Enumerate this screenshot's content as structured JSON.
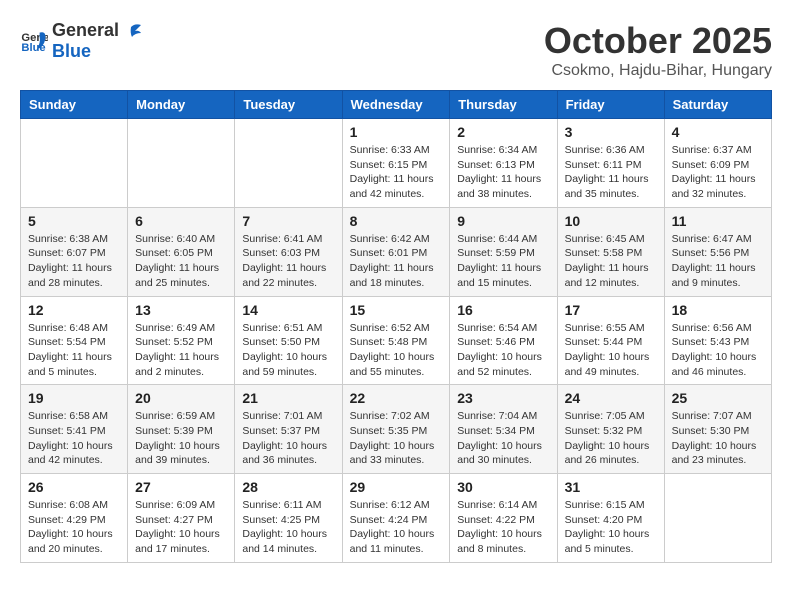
{
  "header": {
    "logo_general": "General",
    "logo_blue": "Blue",
    "month": "October 2025",
    "location": "Csokmo, Hajdu-Bihar, Hungary"
  },
  "weekdays": [
    "Sunday",
    "Monday",
    "Tuesday",
    "Wednesday",
    "Thursday",
    "Friday",
    "Saturday"
  ],
  "weeks": [
    [
      {
        "day": "",
        "info": ""
      },
      {
        "day": "",
        "info": ""
      },
      {
        "day": "",
        "info": ""
      },
      {
        "day": "1",
        "info": "Sunrise: 6:33 AM\nSunset: 6:15 PM\nDaylight: 11 hours\nand 42 minutes."
      },
      {
        "day": "2",
        "info": "Sunrise: 6:34 AM\nSunset: 6:13 PM\nDaylight: 11 hours\nand 38 minutes."
      },
      {
        "day": "3",
        "info": "Sunrise: 6:36 AM\nSunset: 6:11 PM\nDaylight: 11 hours\nand 35 minutes."
      },
      {
        "day": "4",
        "info": "Sunrise: 6:37 AM\nSunset: 6:09 PM\nDaylight: 11 hours\nand 32 minutes."
      }
    ],
    [
      {
        "day": "5",
        "info": "Sunrise: 6:38 AM\nSunset: 6:07 PM\nDaylight: 11 hours\nand 28 minutes."
      },
      {
        "day": "6",
        "info": "Sunrise: 6:40 AM\nSunset: 6:05 PM\nDaylight: 11 hours\nand 25 minutes."
      },
      {
        "day": "7",
        "info": "Sunrise: 6:41 AM\nSunset: 6:03 PM\nDaylight: 11 hours\nand 22 minutes."
      },
      {
        "day": "8",
        "info": "Sunrise: 6:42 AM\nSunset: 6:01 PM\nDaylight: 11 hours\nand 18 minutes."
      },
      {
        "day": "9",
        "info": "Sunrise: 6:44 AM\nSunset: 5:59 PM\nDaylight: 11 hours\nand 15 minutes."
      },
      {
        "day": "10",
        "info": "Sunrise: 6:45 AM\nSunset: 5:58 PM\nDaylight: 11 hours\nand 12 minutes."
      },
      {
        "day": "11",
        "info": "Sunrise: 6:47 AM\nSunset: 5:56 PM\nDaylight: 11 hours\nand 9 minutes."
      }
    ],
    [
      {
        "day": "12",
        "info": "Sunrise: 6:48 AM\nSunset: 5:54 PM\nDaylight: 11 hours\nand 5 minutes."
      },
      {
        "day": "13",
        "info": "Sunrise: 6:49 AM\nSunset: 5:52 PM\nDaylight: 11 hours\nand 2 minutes."
      },
      {
        "day": "14",
        "info": "Sunrise: 6:51 AM\nSunset: 5:50 PM\nDaylight: 10 hours\nand 59 minutes."
      },
      {
        "day": "15",
        "info": "Sunrise: 6:52 AM\nSunset: 5:48 PM\nDaylight: 10 hours\nand 55 minutes."
      },
      {
        "day": "16",
        "info": "Sunrise: 6:54 AM\nSunset: 5:46 PM\nDaylight: 10 hours\nand 52 minutes."
      },
      {
        "day": "17",
        "info": "Sunrise: 6:55 AM\nSunset: 5:44 PM\nDaylight: 10 hours\nand 49 minutes."
      },
      {
        "day": "18",
        "info": "Sunrise: 6:56 AM\nSunset: 5:43 PM\nDaylight: 10 hours\nand 46 minutes."
      }
    ],
    [
      {
        "day": "19",
        "info": "Sunrise: 6:58 AM\nSunset: 5:41 PM\nDaylight: 10 hours\nand 42 minutes."
      },
      {
        "day": "20",
        "info": "Sunrise: 6:59 AM\nSunset: 5:39 PM\nDaylight: 10 hours\nand 39 minutes."
      },
      {
        "day": "21",
        "info": "Sunrise: 7:01 AM\nSunset: 5:37 PM\nDaylight: 10 hours\nand 36 minutes."
      },
      {
        "day": "22",
        "info": "Sunrise: 7:02 AM\nSunset: 5:35 PM\nDaylight: 10 hours\nand 33 minutes."
      },
      {
        "day": "23",
        "info": "Sunrise: 7:04 AM\nSunset: 5:34 PM\nDaylight: 10 hours\nand 30 minutes."
      },
      {
        "day": "24",
        "info": "Sunrise: 7:05 AM\nSunset: 5:32 PM\nDaylight: 10 hours\nand 26 minutes."
      },
      {
        "day": "25",
        "info": "Sunrise: 7:07 AM\nSunset: 5:30 PM\nDaylight: 10 hours\nand 23 minutes."
      }
    ],
    [
      {
        "day": "26",
        "info": "Sunrise: 6:08 AM\nSunset: 4:29 PM\nDaylight: 10 hours\nand 20 minutes."
      },
      {
        "day": "27",
        "info": "Sunrise: 6:09 AM\nSunset: 4:27 PM\nDaylight: 10 hours\nand 17 minutes."
      },
      {
        "day": "28",
        "info": "Sunrise: 6:11 AM\nSunset: 4:25 PM\nDaylight: 10 hours\nand 14 minutes."
      },
      {
        "day": "29",
        "info": "Sunrise: 6:12 AM\nSunset: 4:24 PM\nDaylight: 10 hours\nand 11 minutes."
      },
      {
        "day": "30",
        "info": "Sunrise: 6:14 AM\nSunset: 4:22 PM\nDaylight: 10 hours\nand 8 minutes."
      },
      {
        "day": "31",
        "info": "Sunrise: 6:15 AM\nSunset: 4:20 PM\nDaylight: 10 hours\nand 5 minutes."
      },
      {
        "day": "",
        "info": ""
      }
    ]
  ]
}
